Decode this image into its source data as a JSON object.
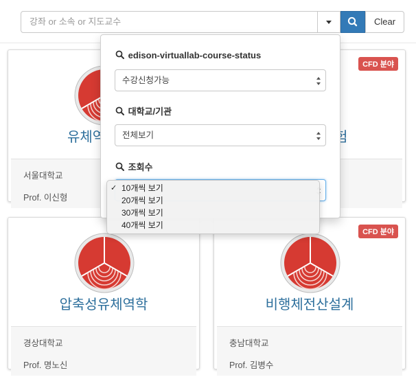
{
  "search": {
    "placeholder": "강좌 or 소속 or 지도교수",
    "clear_label": "Clear"
  },
  "filters": [
    {
      "label": "edison-virtuallab-course-status",
      "value": "수강신청가능"
    },
    {
      "label": "대학교/기관",
      "value": "전체보기"
    },
    {
      "label": "조회수",
      "value": "10개씩 보기"
    }
  ],
  "view_options": [
    "10개씩 보기",
    "20개씩 보기",
    "30개씩 보기",
    "40개씩 보기"
  ],
  "selected_option_index": 0,
  "checkmark": "✓",
  "cards": [
    {
      "title": "유체역학 실험",
      "title_left_visible": "유체역",
      "title_right_visible": "험",
      "university": "서울대학교",
      "professor": "Prof. 이신형",
      "badge": "CFD 분야"
    },
    {
      "title": "",
      "university": "",
      "professor": "",
      "badge": "CFD 분야"
    },
    {
      "title": "압축성유체역학",
      "university": "경상대학교",
      "professor": "Prof. 명노신",
      "badge": ""
    },
    {
      "title": "비행체전산설계",
      "university": "충남대학교",
      "professor": "Prof. 김병수",
      "badge": "CFD 분야"
    }
  ],
  "colors": {
    "accent": "#337ab7",
    "badge": "#d9534f",
    "title": "#2d6f9c",
    "logo_red": "#d63a32"
  },
  "icons": {
    "search": "magnifier-icon",
    "caret": "caret-down-icon",
    "logo": "course-logo-icon"
  }
}
